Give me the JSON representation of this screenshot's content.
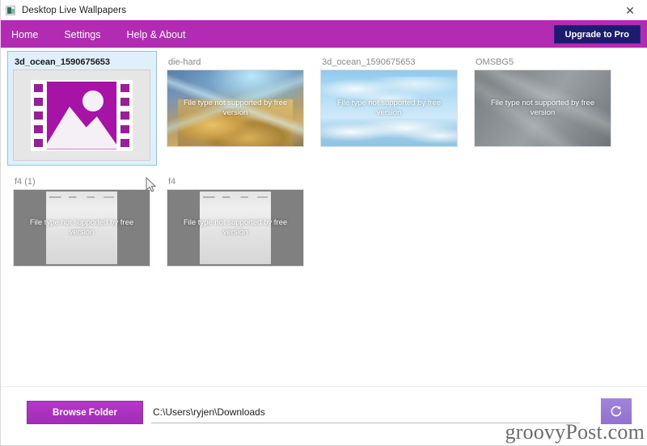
{
  "window": {
    "title": "Desktop Live Wallpapers",
    "app_icon": "app-icon",
    "close_label": "✕"
  },
  "menubar": {
    "items": [
      {
        "label": "Home"
      },
      {
        "label": "Settings"
      },
      {
        "label": "Help & About"
      }
    ],
    "upgrade_label": "Upgrade to Pro",
    "bar_color": "#b32bb3",
    "upgrade_color": "#1c1b6e"
  },
  "gallery": {
    "unsupported_text": "File type not supported by free version",
    "selection_color": "#dff0fa",
    "items": [
      {
        "label": "3d_ocean_1590675653",
        "art": "placeholder",
        "selected": true,
        "overlay": false
      },
      {
        "label": "die-hard",
        "art": "fox",
        "selected": false,
        "overlay": true
      },
      {
        "label": "3d_ocean_1590675653",
        "art": "sky",
        "selected": false,
        "overlay": true
      },
      {
        "label": "OMSBG5",
        "art": "grey",
        "selected": false,
        "overlay": true
      },
      {
        "label": "f4 (1)",
        "art": "doc",
        "selected": false,
        "overlay": true
      },
      {
        "label": "f4",
        "art": "doc",
        "selected": false,
        "overlay": true
      }
    ]
  },
  "bottom": {
    "browse_label": "Browse Folder",
    "path_value": "C:\\Users\\ryjen\\Downloads",
    "path_placeholder": "Select a folder",
    "refresh_icon": "refresh-icon",
    "browse_color": "#ab32c0",
    "refresh_color": "#9b7ad6"
  },
  "watermark": {
    "text": "groovyPost.com"
  }
}
